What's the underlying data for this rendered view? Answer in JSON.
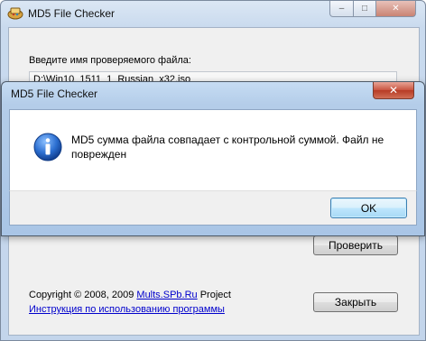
{
  "main_window": {
    "title": "MD5 File Checker",
    "field_label": "Введите имя проверяемого файла:",
    "file_path": "D:\\Win10_1511_1_Russian_x32.iso",
    "verify_button": "Проверить",
    "close_button": "Закрыть",
    "copyright_prefix": "Copyright © 2008, 2009 ",
    "copyright_link": "Mults.SPb.Ru",
    "copyright_suffix": " Project",
    "help_link": "Инструкция по использованию программы"
  },
  "dialog": {
    "title": "MD5 File Checker",
    "message": "MD5 сумма файла совпадает с контрольной суммой. Файл не поврежден",
    "ok_button": "OK",
    "icon": "info-icon"
  },
  "window_controls": {
    "minimize": "minimize-icon",
    "maximize": "maximize-icon",
    "close": "close-icon"
  },
  "colors": {
    "link": "#0000cc",
    "info_icon": "#1f5fbf"
  }
}
